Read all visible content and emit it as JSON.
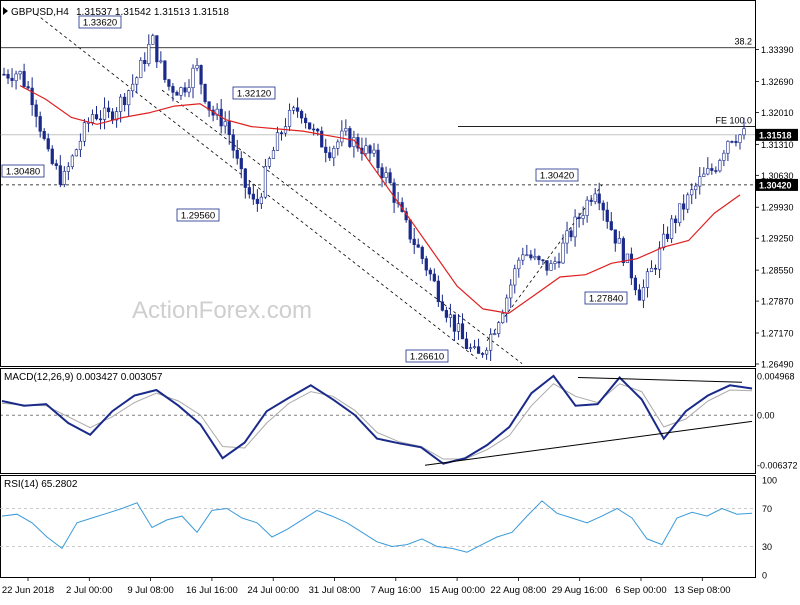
{
  "header": {
    "symbol": "GBPUSD,H4",
    "ohlc": "1.31537 1.31542 1.31513 1.31518"
  },
  "watermark": "ActionForex.com",
  "colors": {
    "candle": "#1a2a8a",
    "ma": "#e02020",
    "macd_line": "#1a2a8a",
    "signal_line": "#aaaaaa",
    "rsi_line": "#3a9ad9",
    "trendline": "#000000",
    "label_border": "#1a2a8a",
    "price_tag_bg": "#000000"
  },
  "chart_data": [
    {
      "type": "candlestick",
      "panel": "price",
      "ylim": [
        1.2649,
        1.3439
      ],
      "y_ticks": [
        "1.33390",
        "1.32690",
        "1.32010",
        "1.31310",
        "1.30630",
        "1.29930",
        "1.29250",
        "1.28550",
        "1.27870",
        "1.27170",
        "1.26490"
      ],
      "x_ticks": [
        "22 Jun 2018",
        "2 Jul 00:00",
        "9 Jul 08:00",
        "16 Jul 16:00",
        "24 Jul 00:00",
        "31 Jul 08:00",
        "7 Aug 16:00",
        "15 Aug 00:00",
        "22 Aug 08:00",
        "29 Aug 16:00",
        "6 Sep 00:00",
        "13 Sep 08:00"
      ],
      "close_path": [
        1.3285,
        1.329,
        1.323,
        1.31,
        1.305,
        1.313,
        1.32,
        1.319,
        1.323,
        1.328,
        1.3362,
        1.326,
        1.325,
        1.33,
        1.32,
        1.318,
        1.306,
        1.299,
        1.31,
        1.318,
        1.3212,
        1.315,
        1.312,
        1.315,
        1.313,
        1.31,
        1.305,
        1.296,
        1.29,
        1.283,
        1.276,
        1.27,
        1.2661,
        1.272,
        1.28,
        1.29,
        1.287,
        1.286,
        1.292,
        1.298,
        1.3042,
        1.295,
        1.288,
        1.28,
        1.287,
        1.295,
        1.3,
        1.305,
        1.308,
        1.315,
        1.3152
      ],
      "moving_average": [
        1.326,
        1.323,
        1.319,
        1.3175,
        1.319,
        1.32,
        1.3215,
        1.322,
        1.3185,
        1.317,
        1.3165,
        1.316,
        1.315,
        1.314,
        1.306,
        1.298,
        1.29,
        1.282,
        1.277,
        1.276,
        1.28,
        1.284,
        1.2845,
        1.287,
        1.288,
        1.2905,
        1.292,
        1.298,
        1.302
      ],
      "levels": [
        {
          "label": "38.2",
          "value": 1.3343
        },
        {
          "label": "FE 100.0",
          "value": 1.317
        },
        {
          "label": "1.30420",
          "value": 1.3042
        },
        {
          "label": "1.31518",
          "value": 1.31518
        }
      ],
      "annotations": [
        "1.33620",
        "1.32120",
        "1.30480",
        "1.29560",
        "1.30420",
        "1.27840",
        "1.26610"
      ],
      "last_price": "1.31518"
    },
    {
      "type": "line",
      "panel": "macd",
      "title": "MACD(12,26,9) 0.003427 0.003057",
      "ylim": [
        -0.007,
        0.0055
      ],
      "y_ticks": [
        "0.004968",
        "0.00",
        "-0.006372"
      ],
      "series": [
        {
          "name": "MACD",
          "values": [
            0.0018,
            0.0012,
            0.0014,
            -0.001,
            -0.0025,
            0.0005,
            0.0025,
            0.0032,
            0.0012,
            -0.0012,
            -0.0055,
            -0.0035,
            0.0005,
            0.0022,
            0.0038,
            0.002,
            0.0,
            -0.003,
            -0.0036,
            -0.0041,
            -0.0062,
            -0.0055,
            -0.0038,
            -0.0015,
            0.0028,
            0.005,
            0.0012,
            0.0014,
            0.0048,
            0.002,
            -0.003,
            0.0005,
            0.0025,
            0.0038,
            0.0034
          ]
        },
        {
          "name": "Signal",
          "values": [
            0.0015,
            0.0013,
            0.0012,
            -0.0002,
            -0.0016,
            -0.0002,
            0.0016,
            0.0028,
            0.0018,
            0.0,
            -0.004,
            -0.0042,
            -0.001,
            0.0015,
            0.003,
            0.0024,
            0.0006,
            -0.0022,
            -0.0034,
            -0.004,
            -0.0056,
            -0.0056,
            -0.0044,
            -0.0026,
            0.0012,
            0.004,
            0.0024,
            0.0016,
            0.004,
            0.003,
            -0.0015,
            -0.0005,
            0.0018,
            0.0032,
            0.0031
          ]
        }
      ],
      "zero_line": 0,
      "trendlines": [
        "support",
        "resistance"
      ]
    },
    {
      "type": "line",
      "panel": "rsi",
      "title": "RSI(14) 65.2802",
      "ylim": [
        0,
        100
      ],
      "y_ticks": [
        "100",
        "70",
        "30",
        "0"
      ],
      "levels": [
        70,
        30
      ],
      "series": [
        {
          "name": "RSI",
          "values": [
            62,
            64,
            55,
            40,
            28,
            55,
            60,
            65,
            70,
            76,
            50,
            58,
            62,
            45,
            68,
            70,
            60,
            55,
            40,
            48,
            58,
            68,
            62,
            55,
            45,
            35,
            30,
            32,
            38,
            30,
            28,
            24,
            32,
            40,
            45,
            62,
            78,
            65,
            60,
            55,
            62,
            70,
            60,
            38,
            32,
            60,
            66,
            62,
            70,
            64,
            65
          ]
        }
      ]
    }
  ]
}
